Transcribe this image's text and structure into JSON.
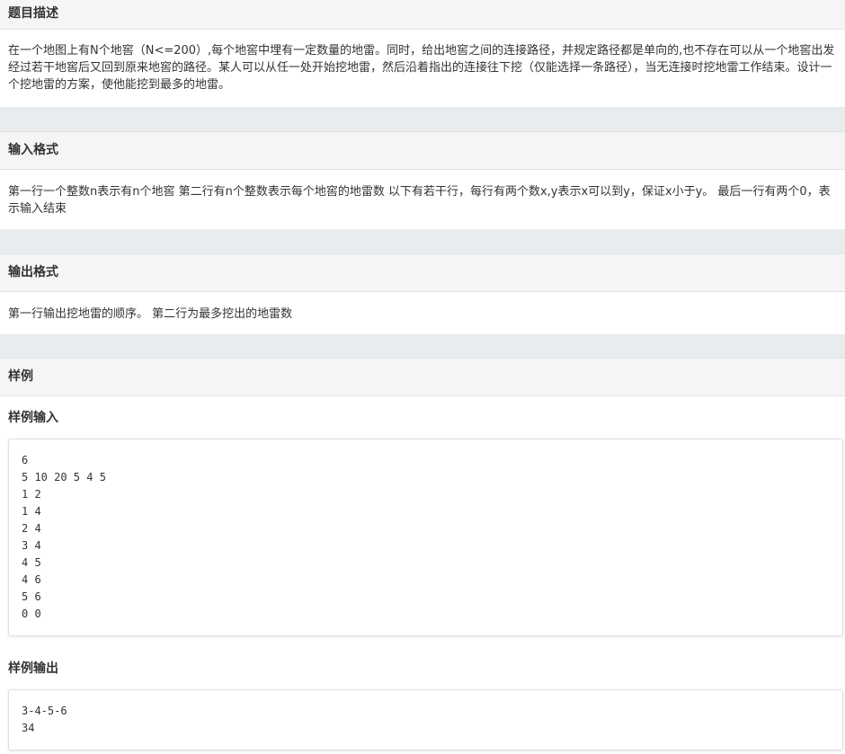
{
  "description": {
    "title": "题目描述",
    "text": "在一个地图上有N个地窖（N<=200）,每个地窖中埋有一定数量的地雷。同时，给出地窖之间的连接路径，并规定路径都是单向的,也不存在可以从一个地窖出发经过若干地窖后又回到原来地窖的路径。某人可以从任一处开始挖地雷，然后沿着指出的连接往下挖（仅能选择一条路径），当无连接时挖地雷工作结束。设计一个挖地雷的方案，使他能挖到最多的地雷。"
  },
  "input_format": {
    "title": "输入格式",
    "text": "第一行一个整数n表示有n个地窖 第二行有n个整数表示每个地窖的地雷数 以下有若干行，每行有两个数x,y表示x可以到y，保证x小于y。 最后一行有两个0，表示输入结束"
  },
  "output_format": {
    "title": "输出格式",
    "text": "第一行输出挖地雷的顺序。 第二行为最多挖出的地雷数"
  },
  "sample": {
    "title": "样例",
    "input_title": "样例输入",
    "input_lines": [
      "6",
      "5 10 20 5 4 5",
      "1 2",
      "1 4",
      "2 4",
      "3 4",
      "4 5",
      "4 6",
      "5 6",
      "0 0"
    ],
    "output_title": "样例输出",
    "output_lines": [
      "3-4-5-6",
      "34"
    ]
  }
}
